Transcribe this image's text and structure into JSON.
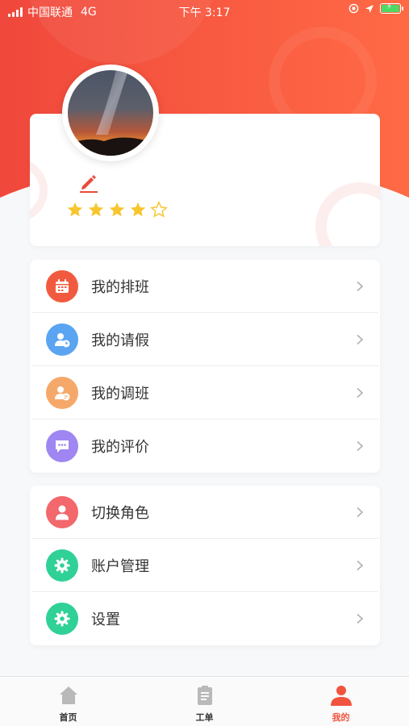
{
  "status_bar": {
    "carrier": "中国联通",
    "network": "4G",
    "time": "下午 3:17"
  },
  "colors": {
    "brand": "#f2533e",
    "hero_start": "#f0483c",
    "hero_end": "#ff6a45",
    "star": "#f7c62f"
  },
  "profile": {
    "rating": 4,
    "max_rating": 5,
    "edit_icon": "pencil-icon"
  },
  "menu_group_1": [
    {
      "label": "我的排班",
      "icon": "calendar-icon",
      "color": "#f25a3f"
    },
    {
      "label": "我的请假",
      "icon": "user-clock-icon",
      "color": "#5aa4f2"
    },
    {
      "label": "我的调班",
      "icon": "user-swap-icon",
      "color": "#f5a86a"
    },
    {
      "label": "我的评价",
      "icon": "comment-icon",
      "color": "#9f86f2"
    }
  ],
  "menu_group_2": [
    {
      "label": "切换角色",
      "icon": "user-icon",
      "color": "#f2686c"
    },
    {
      "label": "账户管理",
      "icon": "gear-icon",
      "color": "#2fd196"
    },
    {
      "label": "设置",
      "icon": "gear-icon",
      "color": "#2fd196"
    }
  ],
  "tab_bar": [
    {
      "label": "首页",
      "icon": "home-icon",
      "active": false
    },
    {
      "label": "工单",
      "icon": "clipboard-icon",
      "active": false
    },
    {
      "label": "我的",
      "icon": "person-icon",
      "active": true
    }
  ]
}
